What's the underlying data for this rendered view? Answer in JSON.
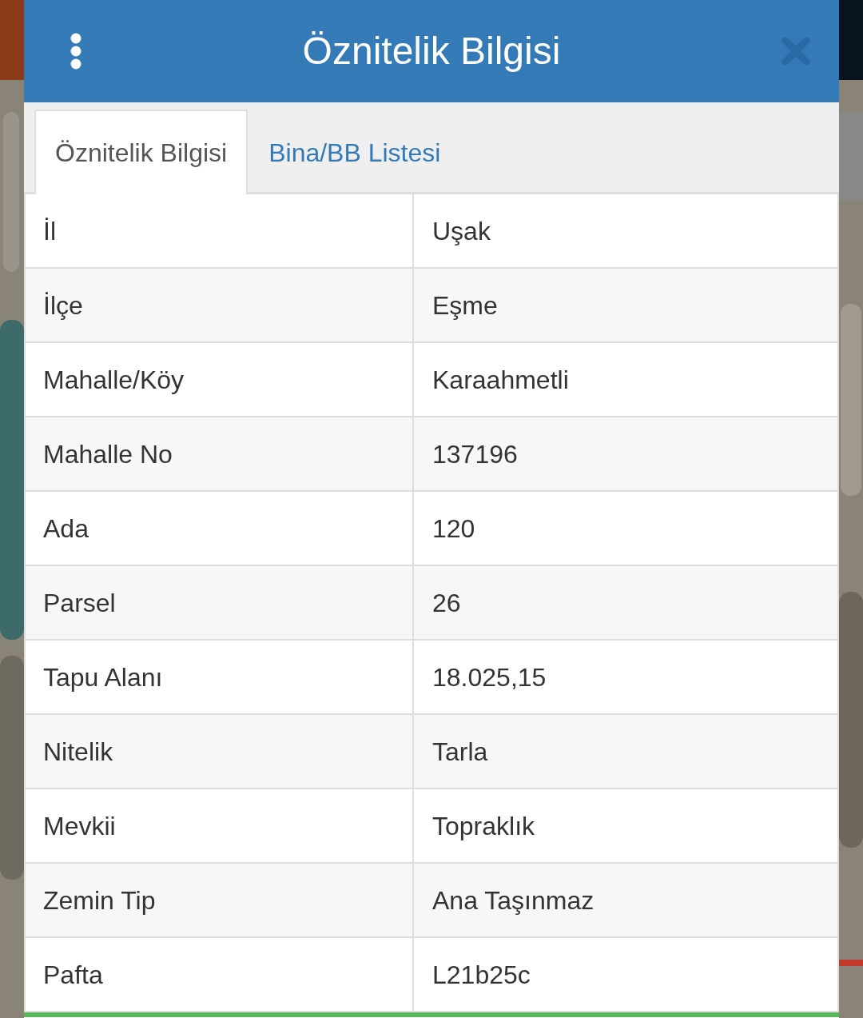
{
  "header": {
    "title": "Öznitelik Bilgisi"
  },
  "tabs": [
    {
      "label": "Öznitelik Bilgisi",
      "selected": true
    },
    {
      "label": "Bina/BB Listesi",
      "selected": false
    }
  ],
  "table": {
    "rows": [
      {
        "label": "İl",
        "value": "Uşak"
      },
      {
        "label": "İlçe",
        "value": "Eşme"
      },
      {
        "label": "Mahalle/Köy",
        "value": "Karaahmetli"
      },
      {
        "label": "Mahalle No",
        "value": "137196"
      },
      {
        "label": "Ada",
        "value": "120"
      },
      {
        "label": "Parsel",
        "value": "26"
      },
      {
        "label": "Tapu Alanı",
        "value": "18.025,15"
      },
      {
        "label": "Nitelik",
        "value": "Tarla"
      },
      {
        "label": "Mevkii",
        "value": "Topraklık"
      },
      {
        "label": "Zemin Tip",
        "value": "Ana Taşınmaz"
      },
      {
        "label": "Pafta",
        "value": "L21b25c"
      }
    ]
  }
}
